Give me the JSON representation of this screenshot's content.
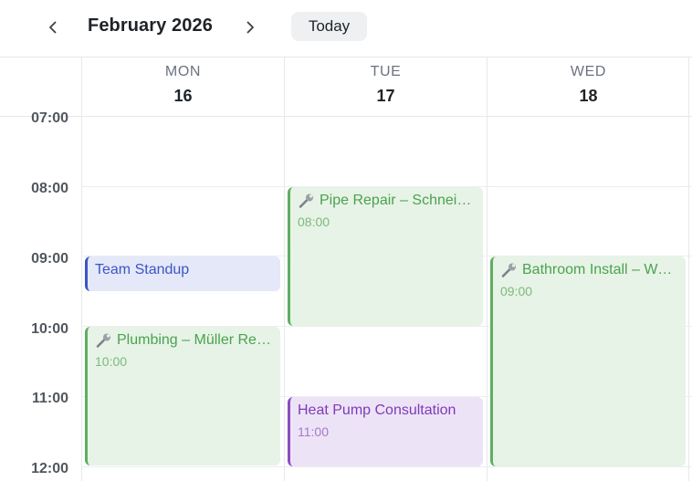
{
  "header": {
    "month_title": "February 2026",
    "prev_icon": "chevron-left-icon",
    "next_icon": "chevron-right-icon",
    "today_label": "Today"
  },
  "days": [
    {
      "name": "MON",
      "number": "16"
    },
    {
      "name": "TUE",
      "number": "17"
    },
    {
      "name": "WED",
      "number": "18"
    }
  ],
  "time_labels": [
    "07:00",
    "08:00",
    "09:00",
    "10:00",
    "11:00",
    "12:00"
  ],
  "events": [
    {
      "title": "Team Standup",
      "time": "",
      "day": "MON",
      "start": "09:00",
      "end": "09:30",
      "icon": "",
      "color": "#3b55c4"
    },
    {
      "title": "Plumbing – Müller Residence",
      "time": "10:00",
      "day": "MON",
      "start": "10:00",
      "end": "12:00",
      "icon": "wrench-icon",
      "color": "#5fae62"
    },
    {
      "title": "Pipe Repair – Schneider",
      "time": "08:00",
      "day": "TUE",
      "start": "08:00",
      "end": "10:00",
      "icon": "wrench-icon",
      "color": "#5fae62"
    },
    {
      "title": "Heat Pump Consultation",
      "time": "11:00",
      "day": "TUE",
      "start": "11:00",
      "end": "12:00",
      "icon": "",
      "color": "#8a4cc2"
    },
    {
      "title": "Bathroom Install – Weber",
      "time": "09:00",
      "day": "WED",
      "start": "09:00",
      "end": "12:00",
      "icon": "wrench-icon",
      "color": "#5fae62"
    }
  ]
}
